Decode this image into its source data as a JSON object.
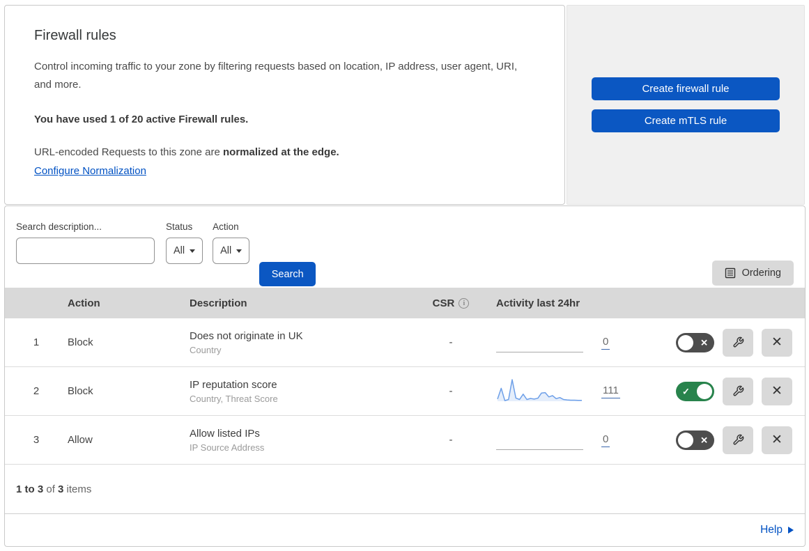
{
  "header": {
    "title": "Firewall rules",
    "description": "Control incoming traffic to your zone by filtering requests based on location, IP address, user agent, URI, and more.",
    "usage_note": "You have used 1 of 20 active Firewall rules.",
    "normalization_prefix": "URL-encoded Requests to this zone are ",
    "normalization_bold": "normalized at the edge.",
    "normalization_link": "Configure Normalization"
  },
  "actions_panel": {
    "create_firewall_rule_label": "Create firewall rule",
    "create_mtls_rule_label": "Create mTLS rule"
  },
  "filters": {
    "search_label": "Search description...",
    "search_value": "",
    "status_label": "Status",
    "status_value": "All",
    "action_label": "Action",
    "action_value": "All",
    "search_button_label": "Search",
    "ordering_button_label": "Ordering"
  },
  "table": {
    "columns": {
      "action": "Action",
      "description": "Description",
      "csr": "CSR",
      "activity": "Activity last 24hr"
    },
    "rows": [
      {
        "index": "1",
        "action": "Block",
        "description": "Does not originate in UK",
        "fields": "Country",
        "csr": "-",
        "activity_count": "0",
        "enabled": false
      },
      {
        "index": "2",
        "action": "Block",
        "description": "IP reputation score",
        "fields": "Country, Threat Score",
        "csr": "-",
        "activity_count": "111",
        "enabled": true
      },
      {
        "index": "3",
        "action": "Allow",
        "description": "Allow listed IPs",
        "fields": "IP Source Address",
        "csr": "-",
        "activity_count": "0",
        "enabled": false
      }
    ],
    "activity_sparkline_row2": [
      10,
      60,
      3,
      8,
      100,
      15,
      8,
      33,
      8,
      13,
      10,
      14,
      38,
      40,
      20,
      26,
      12,
      17,
      8,
      6,
      5,
      5,
      4,
      4
    ]
  },
  "footer": {
    "range_text": "1 to 3",
    "of_text": " of ",
    "total_text": "3",
    "items_text": " items",
    "help_label": "Help"
  },
  "colors": {
    "accent_blue": "#0b57c2",
    "link_blue": "#0051c3",
    "toggle_on_green": "#28834c",
    "toggle_off_gray": "#4d4d4d",
    "table_header_bg": "#d9d9d9",
    "side_panel_bg": "#f0f0f0",
    "sparkline_blue": "#6d9fe8"
  }
}
